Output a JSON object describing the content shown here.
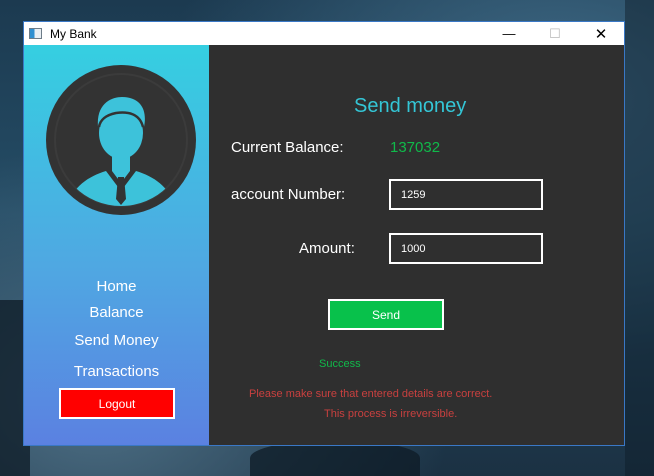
{
  "window": {
    "title": "My Bank",
    "minimize_glyph": "—",
    "maximize_glyph": "☐",
    "close_glyph": "✕"
  },
  "sidebar": {
    "avatar_icon": "user-avatar-icon",
    "items": [
      {
        "label": "Home"
      },
      {
        "label": "Balance"
      },
      {
        "label": "Send Money"
      },
      {
        "label": "Transactions"
      }
    ],
    "logout_label": "Logout",
    "logout_color": "#ff0000"
  },
  "main": {
    "heading": "Send money",
    "current_balance_label": "Current Balance:",
    "current_balance_value": "137032",
    "account_label": "account Number:",
    "account_value": "1259",
    "amount_label": "Amount:",
    "amount_value": "1000",
    "send_label": "Send",
    "send_color": "#08c14b",
    "status": "Success",
    "warning_line1": "Please make sure that entered details are correct.",
    "warning_line2": "This process is irreversible."
  }
}
